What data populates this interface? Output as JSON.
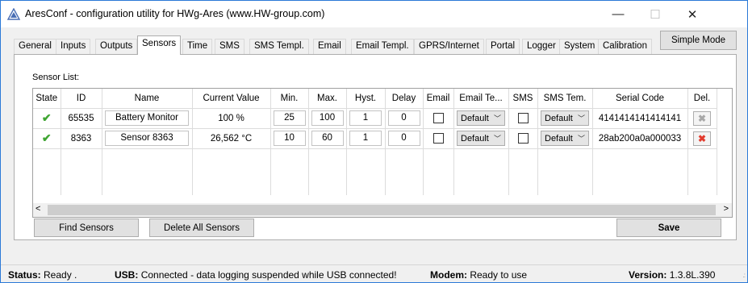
{
  "window": {
    "title": "AresConf - configuration utility for HWg-Ares (www.HW-group.com)",
    "minimize": "—",
    "maximize": "☐",
    "close": "✕"
  },
  "tabs": [
    "General",
    "Inputs",
    "Outputs",
    "Sensors",
    "Time",
    "SMS",
    "SMS Templ.",
    "Email",
    "Email Templ.",
    "GPRS/Internet",
    "Portal",
    "Logger",
    "System",
    "Calibration"
  ],
  "active_tab": "Sensors",
  "simple_mode_button": "Simple Mode",
  "sensor_list_label": "Sensor List:",
  "columns": [
    "State",
    "ID",
    "Name",
    "Current Value",
    "Min.",
    "Max.",
    "Hyst.",
    "Delay",
    "Email",
    "Email Te...",
    "SMS",
    "SMS Tem.",
    "Serial Code",
    "Del."
  ],
  "rows": [
    {
      "state": "✔",
      "id": "65535",
      "name": "Battery Monitor",
      "current_value": "100 %",
      "min": "25",
      "max": "100",
      "hyst": "1",
      "delay": "0",
      "email_template": "Default",
      "sms_template": "Default",
      "serial_code": "4141414141414141",
      "delete": "✖"
    },
    {
      "state": "✔",
      "id": "8363",
      "name": "Sensor 8363",
      "current_value": "26,562 °C",
      "min": "10",
      "max": "60",
      "hyst": "1",
      "delay": "0",
      "email_template": "Default",
      "sms_template": "Default",
      "serial_code": "28ab200a0a000033",
      "delete": "✖"
    }
  ],
  "buttons": {
    "find_sensors": "Find Sensors",
    "delete_all": "Delete All Sensors",
    "save": "Save"
  },
  "status": {
    "status_label": "Status:",
    "status_value": "Ready .",
    "usb_label": "USB:",
    "usb_value": "Connected - data logging suspended while USB connected!",
    "modem_label": "Modem:",
    "modem_value": "Ready to use",
    "version_label": "Version:",
    "version_value": "1.3.8L.390"
  },
  "colors": {
    "ok_check": "#3fa532",
    "delete_active": "#e23b2e",
    "delete_disabled": "#a8a8a8",
    "window_border": "#2b79d7"
  }
}
